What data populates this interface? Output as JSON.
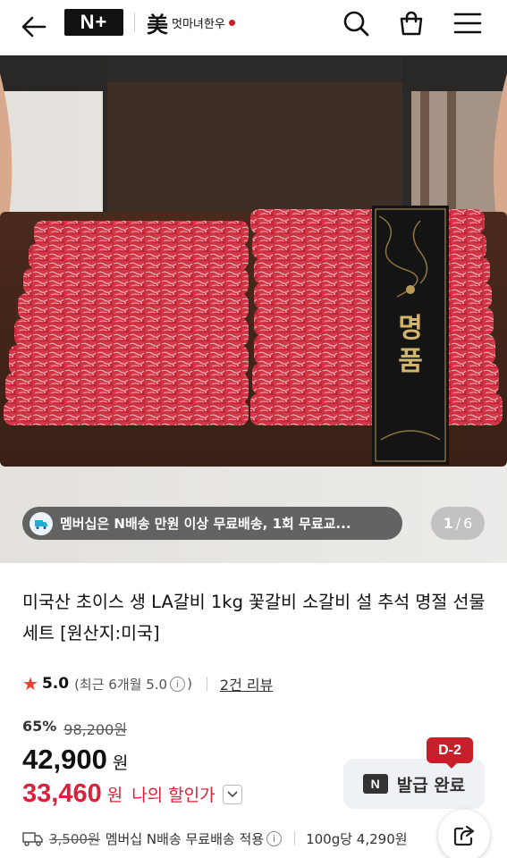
{
  "header": {
    "logo": "N+",
    "brand_name": "멋마녀한우",
    "brand_mark": "美"
  },
  "hero": {
    "promo_text": "멤버십은 N배송 만원 이상 무료배송, 1회 무료교...",
    "counter_current": "1",
    "counter_total": "6"
  },
  "product": {
    "title": "미국산 초이스 생 LA갈비 1kg 꽃갈비 소갈비 설 추석 명절 선물 세트 [원산지:미국]",
    "rating_score": "5.0",
    "rating_recent": "(최근 6개월 5.0",
    "rating_recent_close": ")",
    "review_link": "2건 리뷰",
    "discount_rate": "65%",
    "original_price": "98,200원",
    "price": "42,900",
    "price_unit": "원",
    "my_price": "33,460",
    "my_price_unit": "원",
    "my_price_label": "나의 할인가",
    "coupon_badge": "N",
    "coupon_label": "발급 완료",
    "dday": "D-2",
    "shipping_fee": "3,500원",
    "shipping_text": "멤버십 N배송 무료배송 적용",
    "unit_price": "100g당 4,290원"
  },
  "colors": {
    "accent_red": "#d9213a",
    "badge_red": "#c8202b",
    "star": "#e4422e"
  },
  "icons": [
    "back-arrow-icon",
    "search-icon",
    "cart-icon",
    "menu-icon",
    "delivery-icon",
    "info-icon",
    "chevron-down-icon",
    "truck-icon",
    "share-icon"
  ]
}
